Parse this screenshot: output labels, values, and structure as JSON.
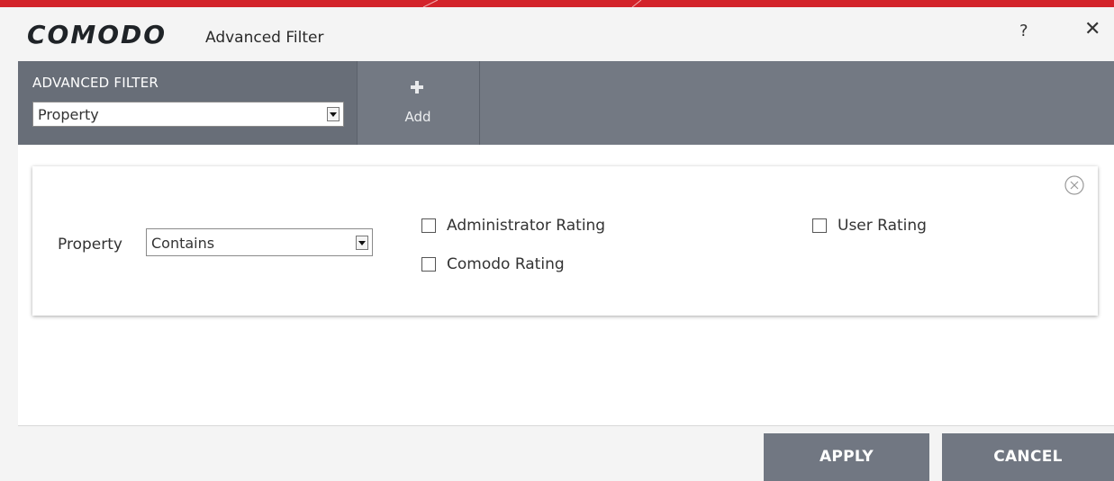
{
  "window": {
    "logo": "COMODO",
    "title": "Advanced Filter",
    "help_glyph": "?",
    "close_glyph": "✕"
  },
  "toolbar": {
    "section_label": "ADVANCED FILTER",
    "filter_select": {
      "value": "Property"
    },
    "add_label": "Add"
  },
  "filter_card": {
    "criterion_label": "Property",
    "condition_select": {
      "value": "Contains"
    },
    "options": [
      {
        "label": "Administrator Rating",
        "checked": false
      },
      {
        "label": "Comodo Rating",
        "checked": false
      },
      {
        "label": "User Rating",
        "checked": false
      }
    ]
  },
  "footer": {
    "apply_label": "APPLY",
    "cancel_label": "CANCEL"
  },
  "colors": {
    "brand_red": "#d3232a",
    "toolbar": "#737983",
    "button": "#717782"
  },
  "icons": [
    "plus-icon",
    "remove-circle-icon",
    "dropdown-arrow-icon",
    "help-icon",
    "close-icon"
  ]
}
